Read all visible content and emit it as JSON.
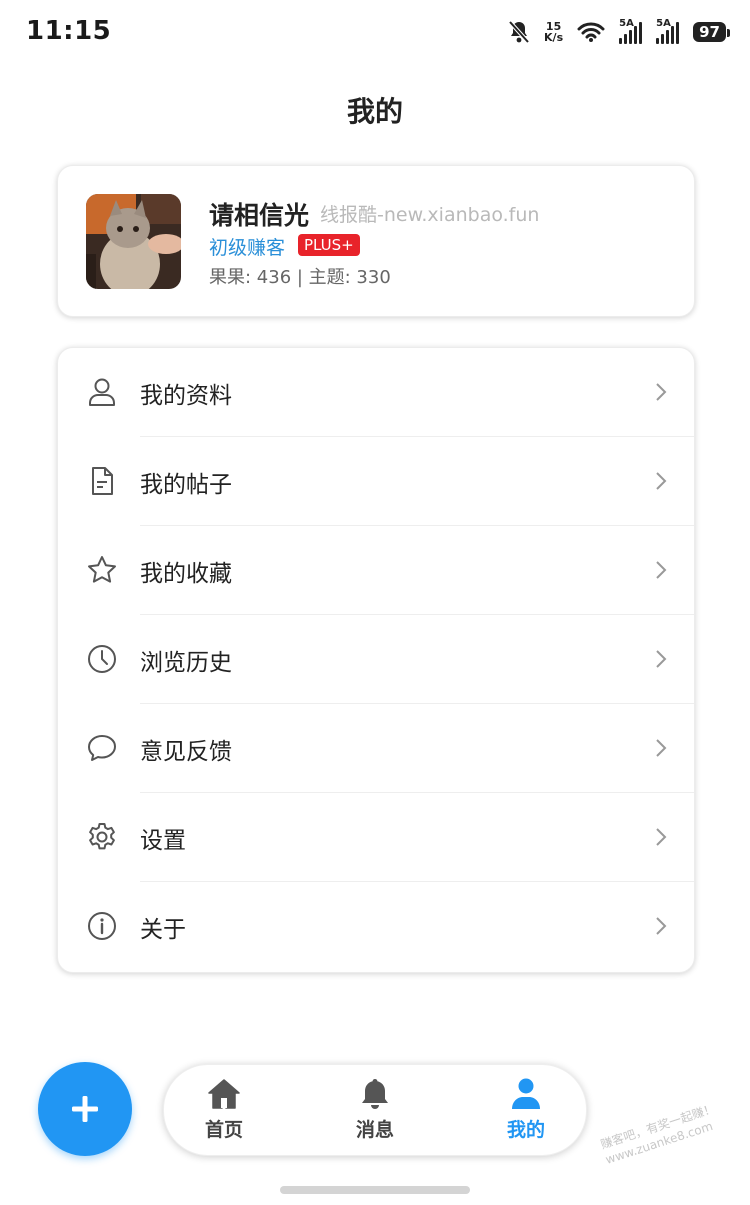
{
  "status_bar": {
    "time": "11:15",
    "speed_value": "15",
    "speed_unit": "K/s",
    "signal1_label": "5A",
    "signal2_label": "5A",
    "battery": "97"
  },
  "header": {
    "title": "我的"
  },
  "profile": {
    "username": "请相信光",
    "watermark": "线报酷-new.xianbao.fun",
    "level": "初级赚客",
    "badge": "PLUS+",
    "stats": "果果: 436 | 主题: 330"
  },
  "menu": {
    "items": [
      {
        "label": "我的资料",
        "icon": "user-icon"
      },
      {
        "label": "我的帖子",
        "icon": "document-icon"
      },
      {
        "label": "我的收藏",
        "icon": "star-icon"
      },
      {
        "label": "浏览历史",
        "icon": "clock-icon"
      },
      {
        "label": "意见反馈",
        "icon": "chat-bubble-icon"
      },
      {
        "label": "设置",
        "icon": "gear-icon"
      },
      {
        "label": "关于",
        "icon": "info-icon"
      }
    ]
  },
  "bottom_nav": {
    "items": [
      {
        "label": "首页",
        "icon": "home-icon",
        "active": false
      },
      {
        "label": "消息",
        "icon": "bell-icon",
        "active": false
      },
      {
        "label": "我的",
        "icon": "person-icon",
        "active": true
      }
    ],
    "fab_icon": "plus-icon"
  },
  "colors": {
    "accent": "#2196f3",
    "level_text": "#2a8fd8",
    "badge_bg": "#e8232a",
    "inactive_nav": "#444444"
  },
  "corner_watermark": [
    "赚客吧，有奖一起赚！",
    "www.zuanke8.com"
  ]
}
